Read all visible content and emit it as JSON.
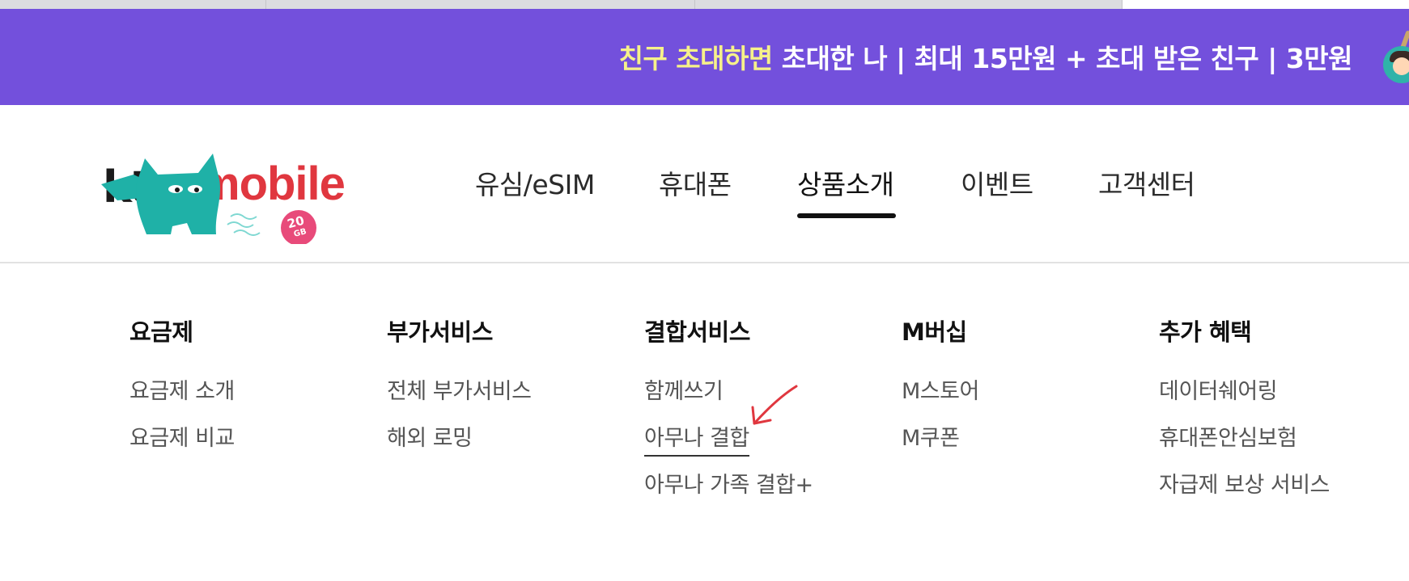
{
  "banner": {
    "highlight": "친구 초대하면",
    "text": " 초대한 나 | 최대 15만원 + 초대 받은 친구 | 3만원",
    "bg_color": "#7350dc",
    "highlight_color": "#f6f18a"
  },
  "logo": {
    "kt": "kt",
    "mobile": "mobile",
    "badge": "20",
    "badge_unit": "GB",
    "mascot": "teal-cat"
  },
  "nav": {
    "items": [
      {
        "label": "유심/eSIM"
      },
      {
        "label": "휴대폰"
      },
      {
        "label": "상품소개",
        "active": true
      },
      {
        "label": "이벤트"
      },
      {
        "label": "고객센터"
      }
    ]
  },
  "menu": {
    "columns": [
      {
        "title": "요금제",
        "links": [
          "요금제 소개",
          "요금제 비교"
        ]
      },
      {
        "title": "부가서비스",
        "links": [
          "전체 부가서비스",
          "해외 로밍"
        ]
      },
      {
        "title": "결합서비스",
        "links": [
          "함께쓰기",
          "아무나 결합",
          "아무나 가족 결합+"
        ]
      },
      {
        "title": "M버십",
        "links": [
          "M스토어",
          "M쿠폰"
        ]
      },
      {
        "title": "추가 혜택",
        "links": [
          "데이터쉐어링",
          "휴대폰안심보험",
          "자급제 보상 서비스"
        ]
      }
    ]
  },
  "annotation": {
    "color": "#e0373f",
    "icon": "red-arrow-icon"
  }
}
